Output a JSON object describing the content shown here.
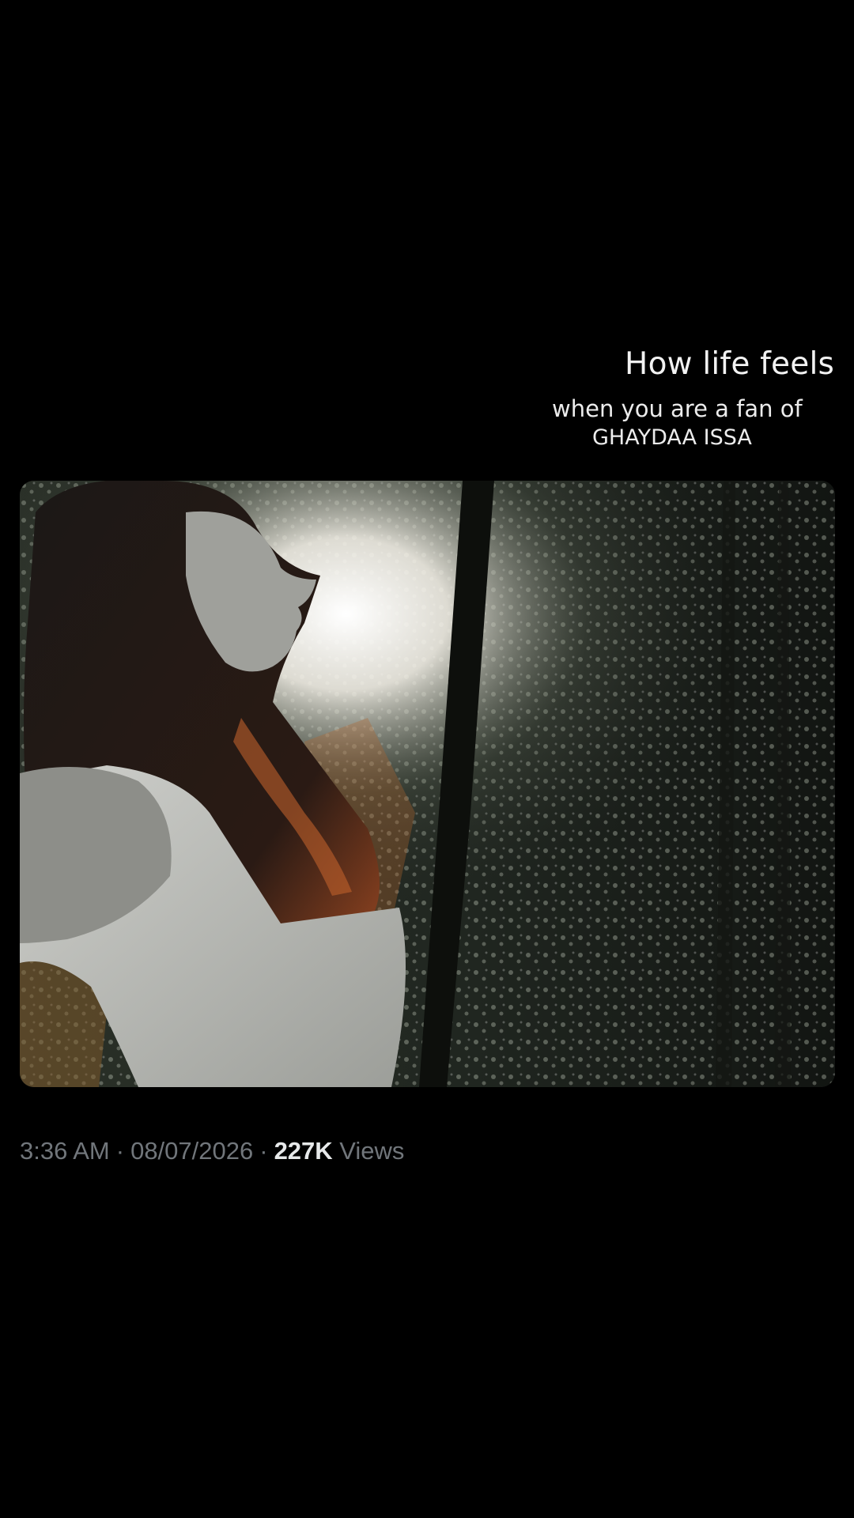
{
  "caption": {
    "title": "How life feels",
    "line2": "when you are a fan of",
    "line3": "GHAYDAA ISSA"
  },
  "post_meta": {
    "time": "3:36 AM",
    "separator": "·",
    "date": "08/07/2026",
    "views_count": "227K",
    "views_label": "Views"
  },
  "colors": {
    "background": "#000000",
    "meta_gray": "#71767b",
    "meta_highlight": "#e7e9ea"
  },
  "media": {
    "icon": "photo-woman-in-forest"
  }
}
